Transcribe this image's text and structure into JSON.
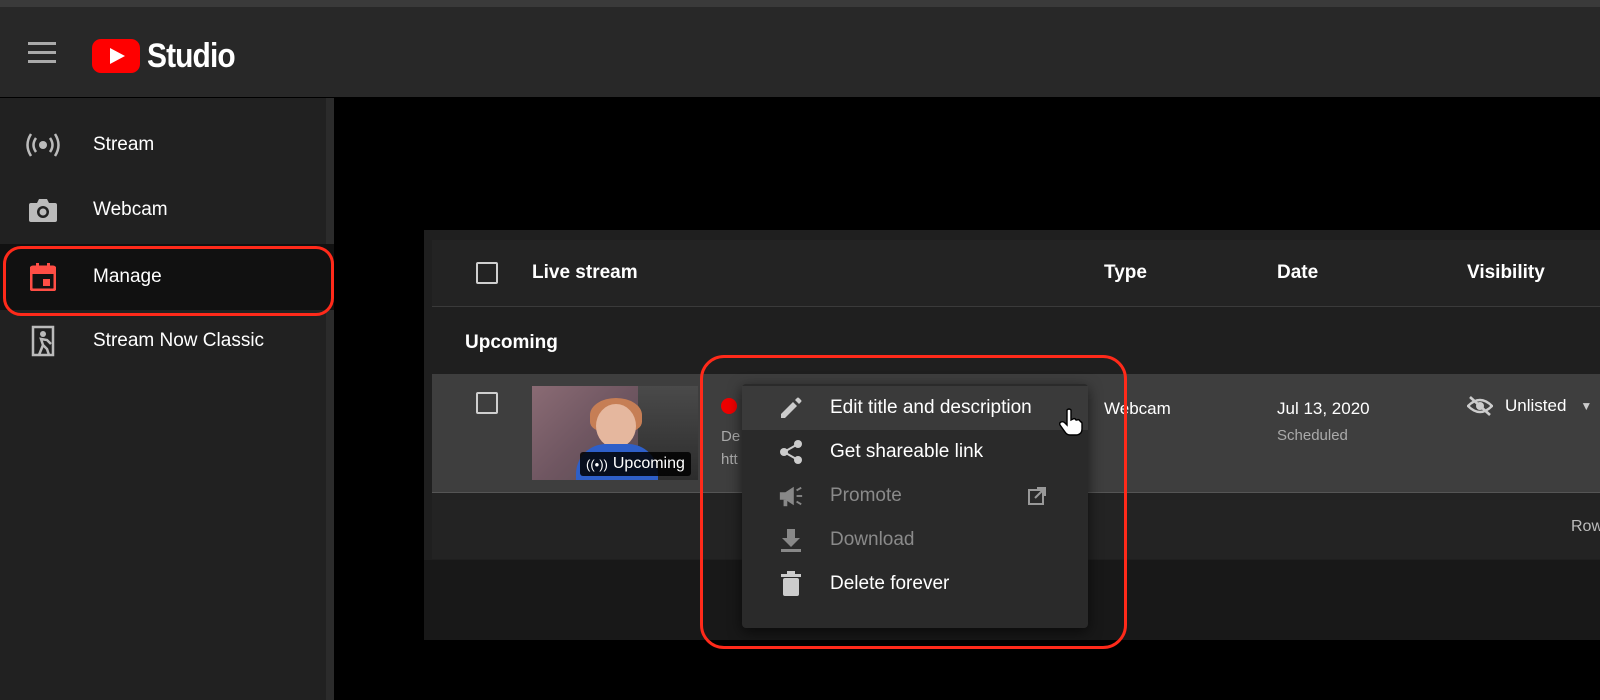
{
  "header": {
    "logo_text": "Studio",
    "brand_color": "#ff0000"
  },
  "sidebar": {
    "items": [
      {
        "label": "Stream",
        "icon": "broadcast-icon"
      },
      {
        "label": "Webcam",
        "icon": "camera-icon"
      },
      {
        "label": "Manage",
        "icon": "calendar-icon",
        "active": true
      },
      {
        "label": "Stream Now Classic",
        "icon": "exit-door-icon"
      }
    ]
  },
  "table": {
    "headers": {
      "stream": "Live stream",
      "type": "Type",
      "date": "Date",
      "visibility": "Visibility"
    },
    "section": "Upcoming",
    "row": {
      "badge": "Upcoming",
      "desc_fragment_1": "De",
      "desc_fragment_2": "htt",
      "type": "Webcam",
      "date": "Jul 13, 2020",
      "status": "Scheduled",
      "visibility": "Unlisted"
    },
    "footer": "Row"
  },
  "context_menu": {
    "items": [
      {
        "label": "Edit title and description",
        "icon": "pencil-icon"
      },
      {
        "label": "Get shareable link",
        "icon": "share-icon"
      },
      {
        "label": "Promote",
        "icon": "megaphone-icon",
        "disabled": true
      },
      {
        "label": "Download",
        "icon": "download-icon",
        "disabled": true
      },
      {
        "label": "Delete forever",
        "icon": "trash-icon"
      }
    ]
  },
  "colors": {
    "highlight": "#ff2a1a",
    "live_dot": "#ee0000"
  }
}
